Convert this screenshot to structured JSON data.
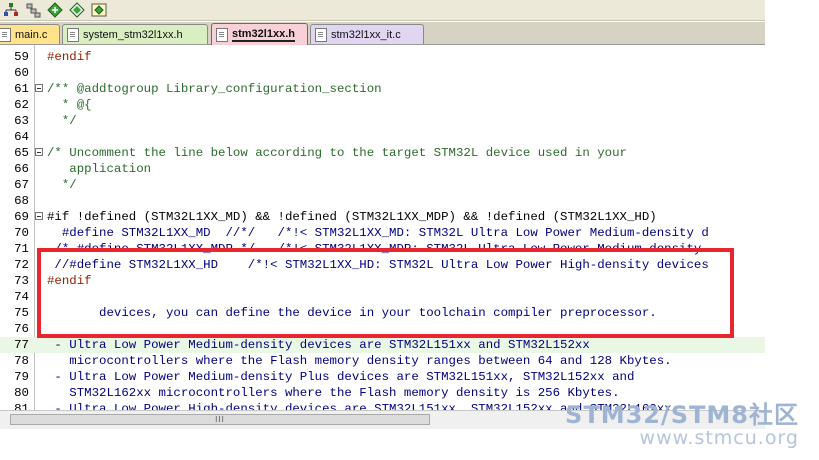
{
  "toolbar": {
    "icons": [
      "tree-icon",
      "hierarchy-icon",
      "diamond-green-icon",
      "diamond-outline-icon",
      "gem-icon"
    ]
  },
  "tabs": [
    {
      "label": "main.c"
    },
    {
      "label": "system_stm32l1xx.h"
    },
    {
      "label": "stm32l1xx.h"
    },
    {
      "label": "stm32l1xx_it.c"
    }
  ],
  "editor": {
    "lines": [
      {
        "num": "59",
        "text": "#endif"
      },
      {
        "num": "60",
        "text": ""
      },
      {
        "num": "61",
        "text": "/** @addtogroup Library_configuration_section"
      },
      {
        "num": "62",
        "text": "  * @{"
      },
      {
        "num": "63",
        "text": "  */"
      },
      {
        "num": "64",
        "text": ""
      },
      {
        "num": "65",
        "text": "/* Uncomment the line below according to the target STM32L device used in your"
      },
      {
        "num": "66",
        "text": "   application"
      },
      {
        "num": "67",
        "text": "  */"
      },
      {
        "num": "68",
        "text": ""
      },
      {
        "num": "69",
        "text": "#if !defined (STM32L1XX_MD) && !defined (STM32L1XX_MDP) && !defined (STM32L1XX_HD)"
      },
      {
        "num": "70",
        "text": "  #define STM32L1XX_MD  //*/   /*!< STM32L1XX_MD: STM32L Ultra Low Power Medium-density d"
      },
      {
        "num": "71",
        "text": " /* #define STM32L1XX_MDP */   /*!< STM32L1XX_MDP: STM32L Ultra Low Power Medium-density"
      },
      {
        "num": "72",
        "text": " //#define STM32L1XX_HD    /*!< STM32L1XX_HD: STM32L Ultra Low Power High-density devices"
      },
      {
        "num": "73",
        "text": "#endif"
      },
      {
        "num": "74",
        "text": ""
      },
      {
        "num": "75",
        "text": "       devices, you can define the device in your toolchain compiler preprocessor."
      },
      {
        "num": "76",
        "text": ""
      },
      {
        "num": "77",
        "text": " - Ultra Low Power Medium-density devices are STM32L151xx and STM32L152xx"
      },
      {
        "num": "78",
        "text": "   microcontrollers where the Flash memory density ranges between 64 and 128 Kbytes."
      },
      {
        "num": "79",
        "text": " - Ultra Low Power Medium-density Plus devices are STM32L151xx, STM32L152xx and"
      },
      {
        "num": "80",
        "text": "   STM32L162xx microcontrollers where the Flash memory density is 256 Kbytes."
      },
      {
        "num": "81",
        "text": " - Ultra Low Power High-density devices are STM32L151xx, STM32L152xx and STM32L162xx"
      }
    ]
  },
  "scrollbar": {
    "thumb_grip": "III"
  },
  "watermark": {
    "title": "STM32/STM8社区",
    "url": "www.stmcu.org"
  }
}
